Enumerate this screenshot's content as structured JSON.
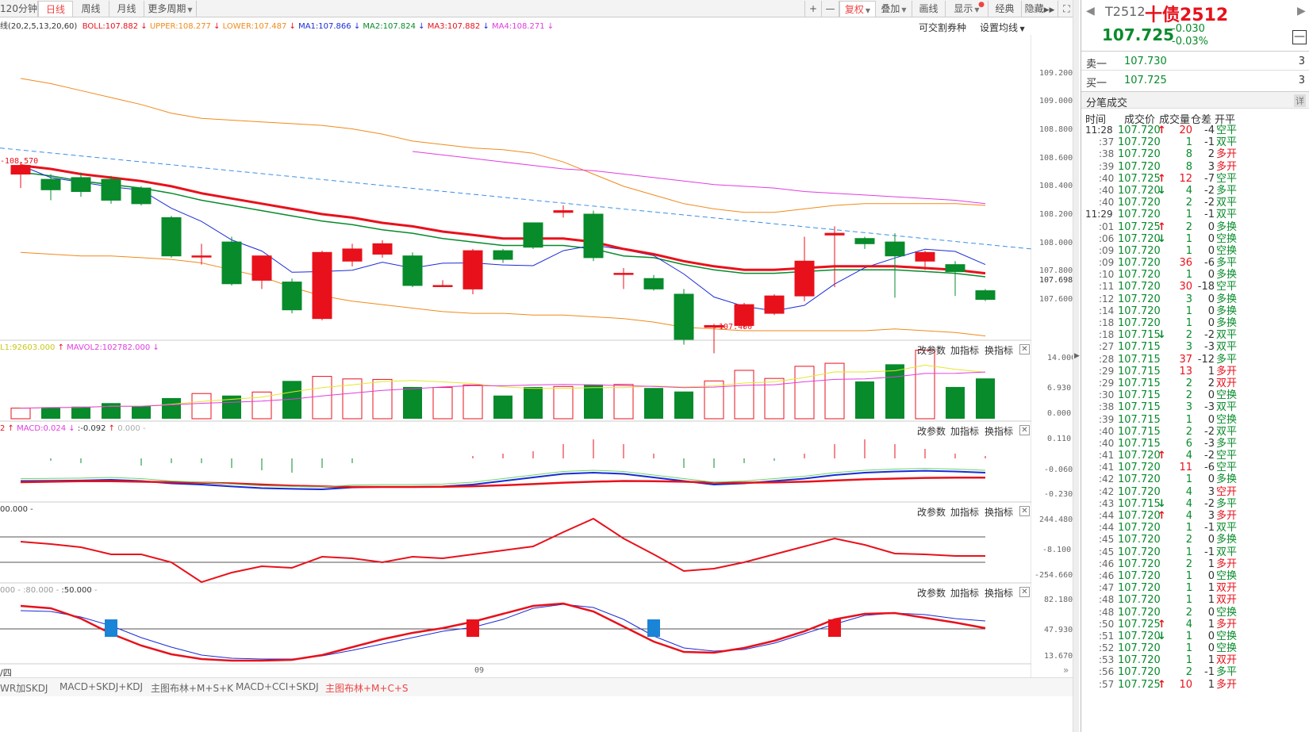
{
  "toolbar": {
    "periods": [
      "120分钟",
      "日线",
      "周线",
      "月线",
      "更多周期"
    ],
    "active_period": "日线",
    "right_tools": [
      "+",
      "—",
      "复权",
      "叠加",
      "画线",
      "显示",
      "经典",
      "隐藏"
    ]
  },
  "legend": {
    "boll_param": "线(20,2,5,13,20,60)",
    "boll": "BOLL:107.882",
    "upper": "UPPER:108.277",
    "lower": "LOWER:107.487",
    "ma1": "MA1:107.866",
    "ma2": "MA2:107.824",
    "ma3": "MA3:107.882",
    "ma4": "MA4:108.271",
    "tradable": "可交割券种",
    "ma_settings": "设置均线"
  },
  "price_axis": [
    "109.200",
    "109.000",
    "108.800",
    "108.600",
    "108.400",
    "108.200",
    "108.000",
    "107.800",
    "107.698",
    "107.600"
  ],
  "annotations": {
    "high": "-108.570",
    "low": "←107.400"
  },
  "panels": {
    "btn_params": "改参数",
    "btn_add": "加指标",
    "btn_swap": "换指标",
    "vol_legend": {
      "mavol1": "L1:92603.000",
      "mavol2": "MAVOL2:102782.000"
    },
    "vol_axis": [
      "14.000",
      "6.930",
      "0.000"
    ],
    "macd_legend": {
      "a": "2",
      "macd": "MACD:0.024",
      "b": ":-0.092",
      "c": "0.000"
    },
    "macd_axis": [
      "0.110",
      "-0.060",
      "-0.230"
    ],
    "cci_legend": "00.000 -",
    "cci_axis": [
      "244.480",
      "-8.100",
      "-254.660"
    ],
    "kdj_legend": {
      "a": "000",
      "b": ":80.000",
      "c": ":50.000"
    },
    "kdj_axis": [
      "82.180",
      "47.930",
      "13.670"
    ]
  },
  "xaxis": {
    "left": "/四",
    "mid": "09"
  },
  "bottom_tabs": [
    "WR加SKDJ",
    "MACD+SKDJ+KDJ",
    "主图布林+M+S+K",
    "MACD+CCI+SKDJ",
    "主图布林+M+C+S"
  ],
  "bottom_active": "主图布林+M+C+S",
  "quote": {
    "code": "T2512",
    "name": "十债2512",
    "price": "107.725",
    "change": "-0.030",
    "pct": "-0.03%",
    "ask_label": "卖一",
    "ask_price": "107.730",
    "ask_vol": "3",
    "bid_label": "买一",
    "bid_price": "107.725",
    "bid_vol": "3",
    "ticks_title": "分笔成交",
    "detail": "详",
    "cols": [
      "时间",
      "成交价",
      "成交量",
      "仓差",
      "开平"
    ]
  },
  "trades": [
    [
      "11:28",
      "107.720",
      "up",
      "20",
      "-4",
      "空平"
    ],
    [
      ":37",
      "107.720",
      "",
      "1",
      "-1",
      "双平"
    ],
    [
      ":38",
      "107.720",
      "",
      "8",
      "2",
      "多开"
    ],
    [
      ":39",
      "107.720",
      "",
      "8",
      "3",
      "多开"
    ],
    [
      ":40",
      "107.725",
      "up",
      "12",
      "-7",
      "空平"
    ],
    [
      ":40",
      "107.720",
      "dn",
      "4",
      "-2",
      "多平"
    ],
    [
      ":40",
      "107.720",
      "",
      "2",
      "-2",
      "双平"
    ],
    [
      "11:29",
      "107.720",
      "",
      "1",
      "-1",
      "双平"
    ],
    [
      ":01",
      "107.725",
      "up",
      "2",
      "0",
      "多换"
    ],
    [
      ":06",
      "107.720",
      "dn",
      "1",
      "0",
      "空换"
    ],
    [
      ":09",
      "107.720",
      "",
      "1",
      "0",
      "空换"
    ],
    [
      ":09",
      "107.720",
      "",
      "36",
      "-6",
      "多平"
    ],
    [
      ":10",
      "107.720",
      "",
      "1",
      "0",
      "多换"
    ],
    [
      ":11",
      "107.720",
      "",
      "30",
      "-18",
      "空平"
    ],
    [
      ":12",
      "107.720",
      "",
      "3",
      "0",
      "多换"
    ],
    [
      ":14",
      "107.720",
      "",
      "1",
      "0",
      "多换"
    ],
    [
      ":18",
      "107.720",
      "",
      "1",
      "0",
      "多换"
    ],
    [
      ":18",
      "107.715",
      "dn",
      "2",
      "-2",
      "双平"
    ],
    [
      ":27",
      "107.715",
      "",
      "3",
      "-3",
      "双平"
    ],
    [
      ":28",
      "107.715",
      "",
      "37",
      "-12",
      "多平"
    ],
    [
      ":29",
      "107.715",
      "",
      "13",
      "1",
      "多开"
    ],
    [
      ":29",
      "107.715",
      "",
      "2",
      "2",
      "双开"
    ],
    [
      ":30",
      "107.715",
      "",
      "2",
      "0",
      "空换"
    ],
    [
      ":38",
      "107.715",
      "",
      "3",
      "-3",
      "双平"
    ],
    [
      ":39",
      "107.715",
      "",
      "1",
      "0",
      "空换"
    ],
    [
      ":40",
      "107.715",
      "",
      "2",
      "-2",
      "双平"
    ],
    [
      ":40",
      "107.715",
      "",
      "6",
      "-3",
      "多平"
    ],
    [
      ":41",
      "107.720",
      "up",
      "4",
      "-2",
      "空平"
    ],
    [
      ":41",
      "107.720",
      "",
      "11",
      "-6",
      "空平"
    ],
    [
      ":42",
      "107.720",
      "",
      "1",
      "0",
      "多换"
    ],
    [
      ":42",
      "107.720",
      "",
      "4",
      "3",
      "空开"
    ],
    [
      ":43",
      "107.715",
      "dn",
      "4",
      "-2",
      "多平"
    ],
    [
      ":44",
      "107.720",
      "up",
      "4",
      "3",
      "多开"
    ],
    [
      ":44",
      "107.720",
      "",
      "1",
      "-1",
      "双平"
    ],
    [
      ":45",
      "107.720",
      "",
      "2",
      "0",
      "多换"
    ],
    [
      ":45",
      "107.720",
      "",
      "1",
      "-1",
      "双平"
    ],
    [
      ":46",
      "107.720",
      "",
      "2",
      "1",
      "多开"
    ],
    [
      ":46",
      "107.720",
      "",
      "1",
      "0",
      "空换"
    ],
    [
      ":47",
      "107.720",
      "",
      "1",
      "1",
      "双开"
    ],
    [
      ":48",
      "107.720",
      "",
      "1",
      "1",
      "双开"
    ],
    [
      ":48",
      "107.720",
      "",
      "2",
      "0",
      "空换"
    ],
    [
      ":50",
      "107.725",
      "up",
      "4",
      "1",
      "多开"
    ],
    [
      ":51",
      "107.720",
      "dn",
      "1",
      "0",
      "空换"
    ],
    [
      ":52",
      "107.720",
      "",
      "1",
      "0",
      "空换"
    ],
    [
      ":53",
      "107.720",
      "",
      "1",
      "1",
      "双开"
    ],
    [
      ":56",
      "107.720",
      "",
      "2",
      "-1",
      "多平"
    ],
    [
      ":57",
      "107.725",
      "up",
      "10",
      "1",
      "多开"
    ]
  ],
  "colors": {
    "up": "#e8111b",
    "down": "#078b2b",
    "ma1": "#1a2bd6",
    "ma2": "#078b2b",
    "ma3": "#e8111b",
    "ma4": "#e13ce0",
    "boll": "#f08a1a",
    "mavol1": "#e6e62a"
  },
  "chart_data": {
    "type": "candlestick",
    "candles": [
      [
        108.45,
        108.5,
        108.37,
        108.52
      ],
      [
        108.42,
        108.36,
        108.3,
        108.45
      ],
      [
        108.43,
        108.35,
        108.32,
        108.46
      ],
      [
        108.42,
        108.3,
        108.28,
        108.44
      ],
      [
        108.37,
        108.28,
        108.27,
        108.38
      ],
      [
        108.2,
        107.98,
        107.97,
        108.21
      ],
      [
        107.98,
        107.98,
        107.93,
        108.05
      ],
      [
        108.06,
        107.82,
        107.81,
        108.09
      ],
      [
        107.84,
        107.98,
        107.79,
        107.98
      ],
      [
        107.83,
        107.67,
        107.65,
        107.85
      ],
      [
        107.62,
        108.0,
        107.61,
        108.01
      ],
      [
        107.95,
        108.02,
        107.92,
        108.05
      ],
      [
        107.99,
        108.05,
        107.97,
        108.07
      ],
      [
        107.98,
        107.81,
        107.8,
        108.0
      ],
      [
        107.81,
        107.81,
        107.8,
        107.84
      ],
      [
        107.79,
        108.01,
        107.76,
        108.02
      ],
      [
        108.01,
        107.96,
        107.94,
        108.02
      ],
      [
        108.17,
        108.03,
        108.02,
        108.17
      ],
      [
        108.23,
        108.24,
        108.2,
        108.27
      ],
      [
        108.22,
        107.97,
        107.95,
        108.24
      ],
      [
        107.88,
        107.88,
        107.79,
        107.91
      ],
      [
        107.85,
        107.79,
        107.78,
        107.87
      ],
      [
        107.76,
        107.5,
        107.47,
        107.79
      ],
      [
        107.57,
        107.58,
        107.42,
        107.59
      ],
      [
        107.58,
        107.7,
        107.56,
        107.71
      ],
      [
        107.65,
        107.75,
        107.64,
        107.76
      ],
      [
        107.75,
        107.95,
        107.72,
        108.09
      ],
      [
        108.1,
        108.11,
        107.8,
        108.15
      ],
      [
        108.08,
        108.05,
        108.02,
        108.09
      ],
      [
        108.06,
        107.98,
        107.74,
        108.11
      ],
      [
        107.95,
        108.0,
        107.9,
        108.01
      ],
      [
        107.93,
        107.89,
        107.75,
        107.95
      ],
      [
        107.78,
        107.73,
        107.72,
        107.79
      ]
    ],
    "volume": [
      2.1,
      2.3,
      2.4,
      3.1,
      2.5,
      4.1,
      5.0,
      4.6,
      5.3,
      7.5,
      8.4,
      7.9,
      7.8,
      6.3,
      6.2,
      6.7,
      4.6,
      6.3,
      6.4,
      6.8,
      6.8,
      6.1,
      5.4,
      7.5,
      9.6,
      8.0,
      10.4,
      11.0,
      7.4,
      10.8,
      13.6,
      6.3,
      8.0,
      3.0
    ],
    "ylim": [
      107.5,
      109.25
    ],
    "vol_ylim": [
      0,
      14
    ]
  }
}
